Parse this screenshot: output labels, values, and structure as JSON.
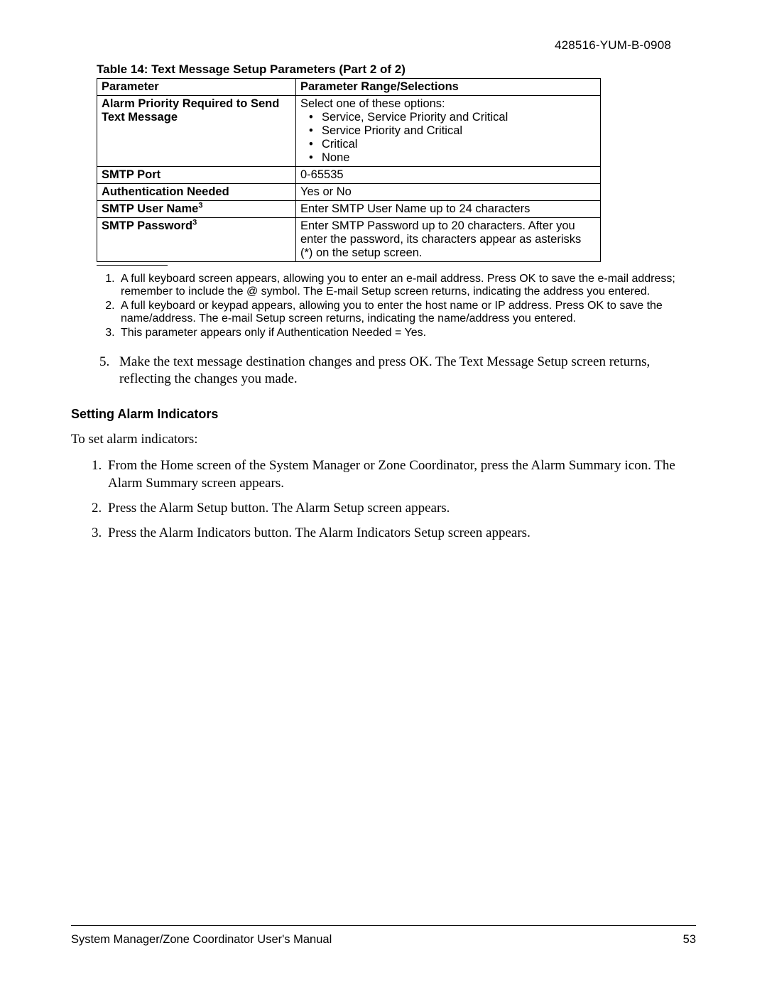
{
  "header": {
    "doc_id": "428516-YUM-B-0908"
  },
  "table": {
    "caption": "Table 14: Text Message Setup Parameters (Part 2 of 2)",
    "col_parameter": "Parameter",
    "col_range": "Parameter Range/Selections",
    "rows": {
      "r1": {
        "param": "Alarm Priority Required to Send Text Message",
        "range_intro": "Select one of these options:",
        "opt1": "Service, Service Priority and Critical",
        "opt2": "Service Priority and Critical",
        "opt3": "Critical",
        "opt4": "None"
      },
      "r2": {
        "param": "SMTP Port",
        "range": "0-65535"
      },
      "r3": {
        "param": "Authentication Needed",
        "range": "Yes or No"
      },
      "r4": {
        "param": "SMTP User Name",
        "sup": "3",
        "range": "Enter SMTP User Name up to 24 characters"
      },
      "r5": {
        "param": "SMTP Password",
        "sup": "3",
        "range": "Enter SMTP Password up to 20 characters. After you enter the password, its characters appear as asterisks (*) on the setup screen."
      }
    }
  },
  "footnotes": {
    "f1": "A full keyboard screen appears, allowing you to enter an e-mail address. Press OK to save the e-mail address; remember to include the @ symbol. The E-mail Setup screen returns, indicating the address you entered.",
    "f2": "A full keyboard or keypad appears, allowing you to enter the host name or IP address. Press OK to save the name/address. The e-mail Setup screen returns, indicating the name/address you entered.",
    "f3": "This parameter appears only if Authentication Needed = Yes."
  },
  "step5": {
    "num": "5.",
    "text": "Make the text message destination changes and press OK. The Text Message Setup screen returns, reflecting the changes you made."
  },
  "section": {
    "heading": "Setting Alarm Indicators",
    "intro": "To set alarm indicators:",
    "s1": "From the Home screen of the System Manager or Zone Coordinator, press the Alarm Summary icon. The Alarm Summary screen appears.",
    "s2": "Press the Alarm Setup button. The Alarm Setup screen appears.",
    "s3": "Press the Alarm Indicators button. The Alarm Indicators Setup screen appears."
  },
  "footer": {
    "title": "System Manager/Zone Coordinator User's Manual",
    "page": "53"
  }
}
